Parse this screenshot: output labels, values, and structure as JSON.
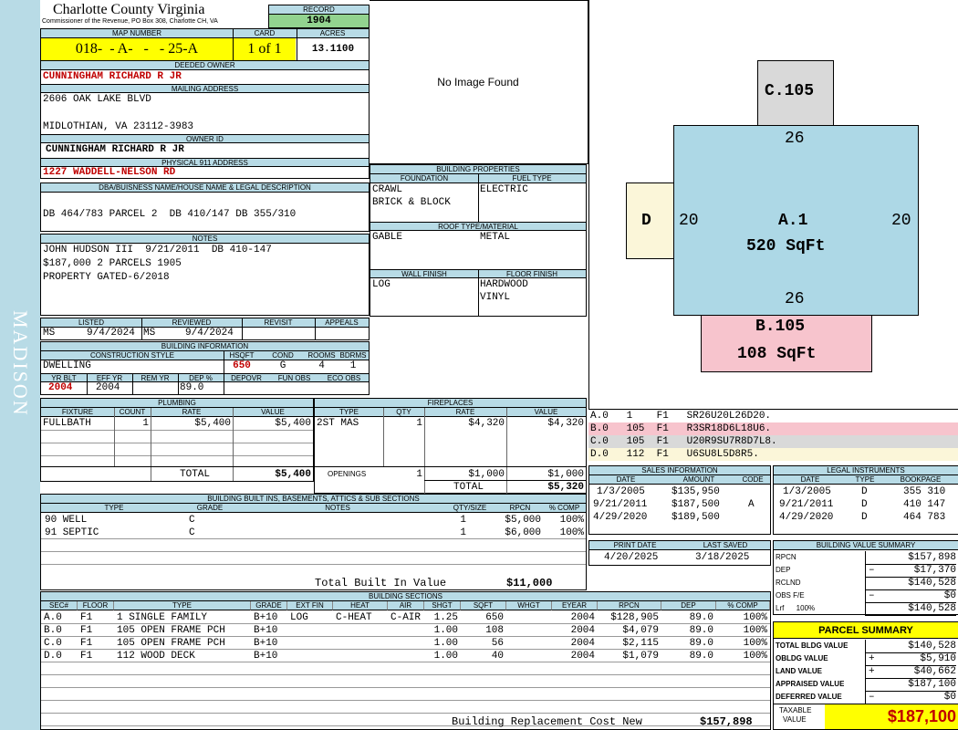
{
  "sidebar_label": "MADISON",
  "county": {
    "name": "Charlotte County Virginia",
    "address": "Commissioner of the Revenue, PO Box 308, Charlotte CH, VA"
  },
  "record": {
    "label": "RECORD",
    "value": "1904"
  },
  "map": {
    "label": "MAP NUMBER",
    "value": "018-  - A-   -   - 25-A",
    "card_label": "CARD",
    "card_value": "1 of 1",
    "acres_label": "ACRES",
    "acres_value": "13.1100"
  },
  "owner": {
    "deeded_label": "DEEDED OWNER",
    "deeded": "CUNNINGHAM RICHARD R JR",
    "mailing_label": "MAILING ADDRESS",
    "mail1": "2606 OAK LAKE BLVD",
    "mail2": "MIDLOTHIAN, VA 23112-3983",
    "id_label": "OWNER ID",
    "id_value": "CUNNINGHAM RICHARD R JR",
    "phys_label": "PHYSICAL 911 ADDRESS",
    "phys": "1227 WADDELL-NELSON RD"
  },
  "dba": {
    "label": "DBA/BUISNESS NAME/HOUSE NAME & LEGAL DESCRIPTION",
    "text": "DB 464/783 PARCEL 2  DB 410/147 DB 355/310"
  },
  "notes": {
    "label": "NOTES",
    "l1": "JOHN HUDSON III  9/21/2011  DB 410-147",
    "l2": "$187,000 2 PARCELS 1905",
    "l3": "PROPERTY GATED-6/2018"
  },
  "listed": {
    "listed_label": "LISTED",
    "reviewed_label": "REVIEWED",
    "revisit_label": "REVISIT",
    "appeals_label": "APPEALS",
    "listed_by": "MS",
    "listed_date": "9/4/2024",
    "reviewed_by": "MS",
    "reviewed_date": "9/4/2024"
  },
  "bldg_info": {
    "label": "BUILDING INFORMATION",
    "style_label": "CONSTRUCTION STYLE",
    "hsqft_label": "HSQFT",
    "cond_label": "COND",
    "rooms_label": "ROOMS",
    "bdrms_label": "BDRMS",
    "style": "DWELLING",
    "hsqft": "650",
    "cond": "G",
    "rooms": "4",
    "bdrms": "1",
    "yrblt_label": "YR BLT",
    "effyr_label": "EFF YR",
    "remyr_label": "REM YR",
    "dep_label": "DEP %",
    "depovr_label": "DEPOVR",
    "funobs_label": "FUN OBS",
    "ecoobs_label": "ECO OBS",
    "yrblt": "2004",
    "effyr": "2004",
    "dep": "89.0"
  },
  "no_image": "No Image Found",
  "bldg_props": {
    "label": "BUILDING PROPERTIES",
    "foundation_label": "FOUNDATION",
    "fuel_label": "FUEL TYPE",
    "foundation1": "CRAWL",
    "foundation2": "BRICK & BLOCK",
    "fuel": "ELECTRIC",
    "roof_label": "ROOF TYPE/MATERIAL",
    "roof1": "GABLE",
    "roof2": "METAL",
    "wall_label": "WALL FINISH",
    "floor_label": "FLOOR FINISH",
    "wall": "LOG",
    "floor1": "HARDWOOD",
    "floor2": "VINYL"
  },
  "sketch": {
    "a_label": "A.1",
    "a_area": "520 SqFt",
    "b_label": "B.105",
    "b_area": "108 SqFt",
    "c_label": "C.105",
    "d_label": "D",
    "dim_top": "26",
    "dim_bottom": "26",
    "dim_left": "20",
    "dim_right": "20"
  },
  "sketch_codes": [
    {
      "text": "A.0   1    F1   SR26U20L26D20.",
      "color": "#ffffff"
    },
    {
      "text": "B.0   105  F1   R3SR18D6L18U6.",
      "color": "#f7c4cd"
    },
    {
      "text": "C.0   105  F1   U20R9SU7R8D7L8.",
      "color": "#d9d9d9"
    },
    {
      "text": "D.0   112  F1   U6SU8L5D8R5.",
      "color": "#fbf6d9"
    }
  ],
  "plumbing": {
    "label": "PLUMBING",
    "cols": [
      "FIXTURE",
      "COUNT",
      "RATE",
      "VALUE"
    ],
    "rows": [
      [
        "FULLBATH",
        "1",
        "$5,400",
        "$5,400"
      ]
    ],
    "total_label": "TOTAL",
    "total": "$5,400"
  },
  "fireplaces": {
    "label": "FIREPLACES",
    "cols": [
      "TYPE",
      "QTY",
      "RATE",
      "VALUE"
    ],
    "rows": [
      [
        "2ST MAS",
        "1",
        "$4,320",
        "$4,320"
      ]
    ],
    "openings_label": "OPENINGS",
    "openings": [
      "1",
      "$1,000",
      "$1,000"
    ],
    "total_label": "TOTAL",
    "total": "$5,320"
  },
  "sales": {
    "label": "SALES INFORMATION",
    "cols": [
      "DATE",
      "AMOUNT",
      "CODE"
    ],
    "rows": [
      [
        "1/3/2005",
        "$135,950",
        ""
      ],
      [
        "9/21/2011",
        "$187,500",
        "A"
      ],
      [
        "4/29/2020",
        "$189,500",
        ""
      ]
    ]
  },
  "legal": {
    "label": "LEGAL INSTRUMENTS",
    "cols": [
      "DATE",
      "TYPE",
      "BOOKPAGE"
    ],
    "rows": [
      [
        "1/3/2005",
        "D",
        "355 310"
      ],
      [
        "9/21/2011",
        "D",
        "410 147"
      ],
      [
        "4/29/2020",
        "D",
        "464 783"
      ]
    ]
  },
  "builtins": {
    "label": "BUILDING BUILT INS, BASEMENTS, ATTICS & SUB SECTIONS",
    "cols": [
      "TYPE",
      "GRADE",
      "NOTES",
      "QTY/SIZE",
      "RPCN",
      "% COMP"
    ],
    "rows": [
      [
        "90 WELL",
        "C",
        "",
        "1",
        "$5,000",
        "100%"
      ],
      [
        "91 SEPTIC",
        "C",
        "",
        "1",
        "$6,000",
        "100%"
      ]
    ],
    "total_label": "Total Built In Value",
    "total": "$11,000"
  },
  "dates": {
    "print_label": "PRINT DATE",
    "saved_label": "LAST SAVED",
    "print": "4/20/2025",
    "saved": "3/18/2025"
  },
  "value_summary": {
    "label": "BUILDING VALUE SUMMARY",
    "rows": [
      [
        "RPCN",
        "",
        "$157,898"
      ],
      [
        "DEP",
        "–",
        "$17,370"
      ],
      [
        "RCLND",
        "",
        "$140,528"
      ],
      [
        "OBS F/E",
        "–",
        "$0"
      ],
      [
        "Lrf      100%",
        "",
        "$140,528"
      ]
    ]
  },
  "sections": {
    "label": "BUILDING SECTIONS",
    "cols": [
      "SEC#",
      "FLOOR",
      "TYPE",
      "GRADE",
      "EXT FIN",
      "HEAT",
      "AIR",
      "SHGT",
      "SQFT",
      "WHGT",
      "EYEAR",
      "RPCN",
      "DEP",
      "% COMP"
    ],
    "rows": [
      [
        "A.0",
        "F1",
        "1 SINGLE FAMILY",
        "B+10",
        "LOG",
        "C-HEAT",
        "C-AIR",
        "1.25",
        "650",
        "",
        "2004",
        "$128,905",
        "89.0",
        "100%"
      ],
      [
        "B.0",
        "F1",
        "105 OPEN FRAME PCH",
        "B+10",
        "",
        "",
        "",
        "1.00",
        "108",
        "",
        "2004",
        "$4,079",
        "89.0",
        "100%"
      ],
      [
        "C.0",
        "F1",
        "105 OPEN FRAME PCH",
        "B+10",
        "",
        "",
        "",
        "1.00",
        "56",
        "",
        "2004",
        "$2,115",
        "89.0",
        "100%"
      ],
      [
        "D.0",
        "F1",
        "112 WOOD DECK",
        "B+10",
        "",
        "",
        "",
        "1.00",
        "40",
        "",
        "2004",
        "$1,079",
        "89.0",
        "100%"
      ]
    ],
    "total_label": "Building Replacement Cost New",
    "total": "$157,898"
  },
  "parcel": {
    "label": "PARCEL SUMMARY",
    "rows": [
      [
        "TOTAL BLDG VALUE",
        "",
        "$140,528"
      ],
      [
        "OBLDG VALUE",
        "+",
        "$5,910"
      ],
      [
        "LAND VALUE",
        "+",
        "$40,662"
      ],
      [
        "APPRAISED VALUE",
        "",
        "$187,100"
      ],
      [
        "DEFERRED VALUE",
        "–",
        "$0"
      ]
    ],
    "taxable_label1": "TAXABLE",
    "taxable_label2": "VALUE",
    "taxable": "$187,100"
  }
}
